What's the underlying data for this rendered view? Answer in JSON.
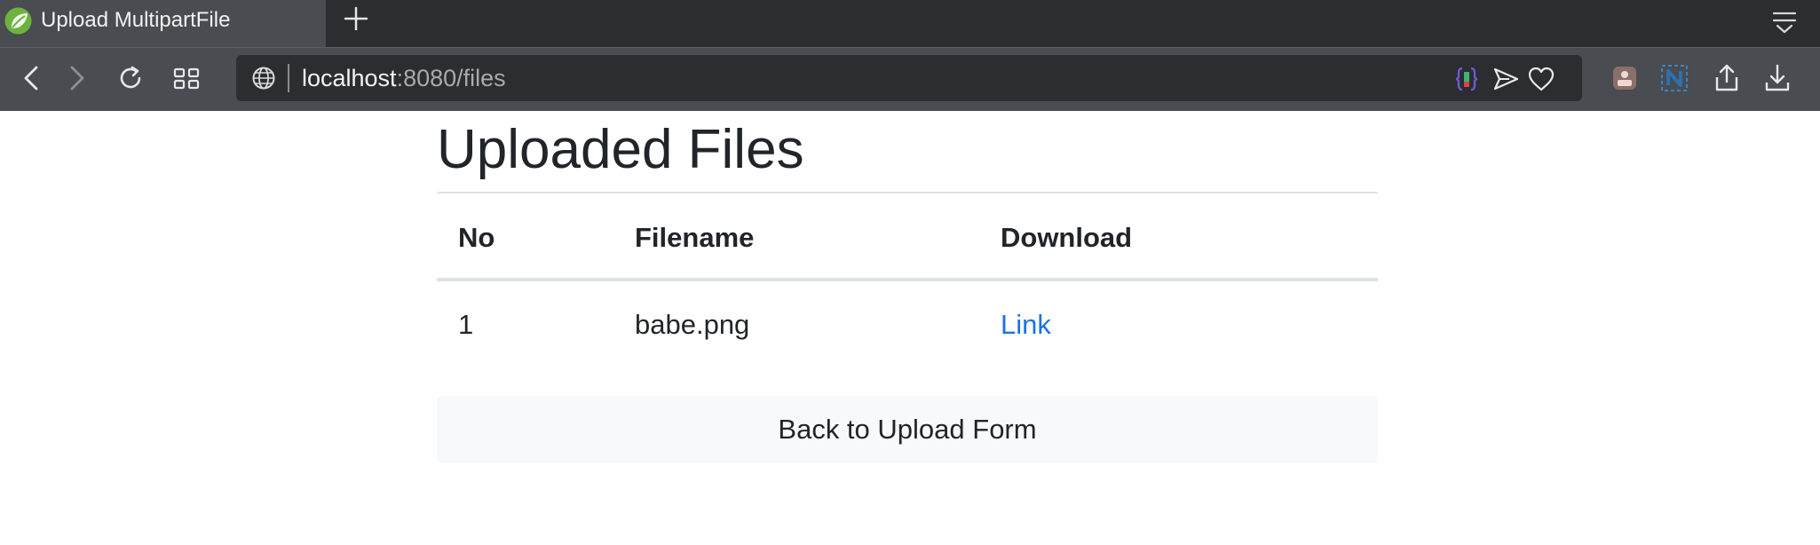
{
  "browser": {
    "tab": {
      "title": "Upload MultipartFile",
      "favicon": "spring-leaf-icon"
    },
    "url": {
      "host": "localhost",
      "rest": ":8080/files"
    },
    "colors": {
      "tabstrip": "#2b2d30",
      "toolbar": "#494c51",
      "urlbar": "#2b2d30"
    }
  },
  "page": {
    "title": "Uploaded Files",
    "table": {
      "headers": [
        "No",
        "Filename",
        "Download"
      ],
      "rows": [
        {
          "no": "1",
          "filename": "babe.png",
          "download": "Link"
        }
      ]
    },
    "back_button_label": "Back to Upload Form",
    "colors": {
      "text": "#212529",
      "link": "#1a73e8",
      "rule": "#dee2e6",
      "button_bg": "#f8f9fa"
    }
  }
}
